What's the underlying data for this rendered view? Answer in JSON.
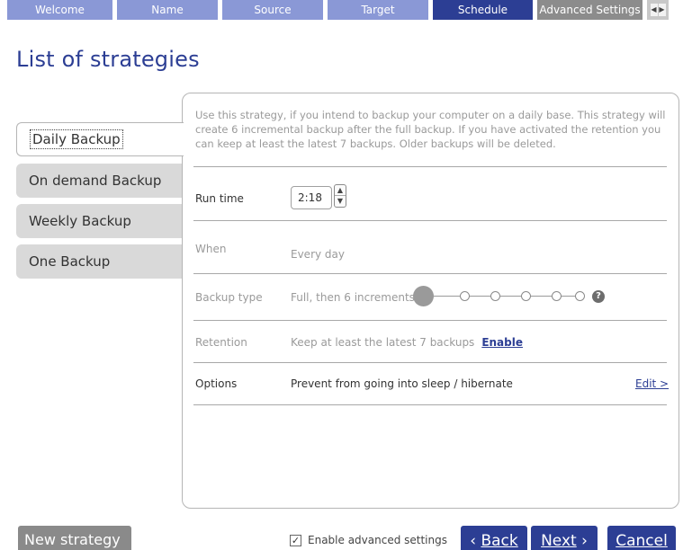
{
  "tabs": [
    "Welcome",
    "Name",
    "Source",
    "Target",
    "Schedule",
    "Advanced Settings"
  ],
  "tab_scroll": {
    "left_icon": "scroll-left-icon",
    "right_icon": "scroll-right-icon"
  },
  "page_title": "List of strategies",
  "strategies": [
    "Daily Backup",
    "On demand Backup",
    "Weekly Backup",
    "One Backup"
  ],
  "description": "Use this strategy, if you intend to backup your computer on a daily base. This strategy will create 6 incremental backup after the full backup. If you have activated the retention you can keep at least the latest 7 backups. Older backups will be deleted.",
  "run_time": {
    "label": "Run time",
    "value": "2:18"
  },
  "when": {
    "label": "When",
    "value": "Every day"
  },
  "backup_type": {
    "label": "Backup type",
    "value": "Full, then 6 increments",
    "increments": 6
  },
  "retention": {
    "label": "Retention",
    "value": "Keep at least the latest 7 backups",
    "link": "Enable"
  },
  "options": {
    "label": "Options",
    "value": "Prevent from going into sleep / hibernate",
    "link": "Edit >"
  },
  "footer": {
    "new_strategy": "New strategy",
    "enable_advanced": "Enable advanced settings",
    "enable_advanced_checked": true,
    "back": "Back",
    "next": "Next",
    "cancel": "Cancel"
  },
  "colors": {
    "accent": "#2c3e94",
    "tab_inactive": "#8a98d6",
    "tab_adv": "#8c8c8c",
    "muted": "#9a9a9a"
  }
}
